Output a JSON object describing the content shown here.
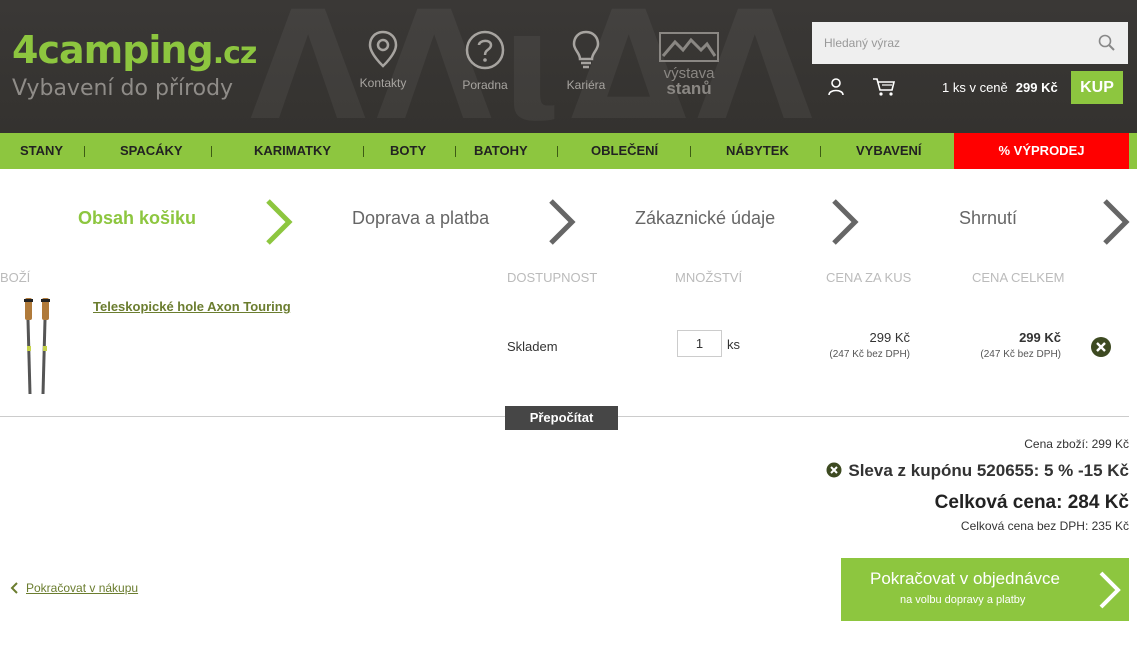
{
  "header": {
    "logo_main": "4camping",
    "logo_tld": ".cz",
    "logo_sub": "Vybavení do přírody",
    "links": [
      {
        "label": "Kontakty",
        "icon": "location-pin-icon"
      },
      {
        "label": "Poradna",
        "icon": "question-icon"
      },
      {
        "label": "Kariéra",
        "icon": "lightbulb-icon"
      }
    ],
    "vystava_line1": "výstava",
    "vystava_line2": "stanů",
    "search_placeholder": "Hledaný výraz",
    "cart_qty": "1 ks v ceně",
    "cart_price": "299 Kč",
    "buy_label": "KUP"
  },
  "nav": {
    "items": [
      "STANY",
      "SPACÁKY",
      "KARIMATKY",
      "BOTY",
      "BATOHY",
      "OBLEČENÍ",
      "NÁBYTEK",
      "VYBAVENÍ"
    ],
    "sale": "% VÝPRODEJ"
  },
  "steps": [
    "Obsah košiku",
    "Doprava a platba",
    "Zákaznické údaje",
    "Shrnutí"
  ],
  "table": {
    "headers": {
      "product": "ZBOŽÍ",
      "availability": "DOSTUPNOST",
      "quantity": "MNOŽSTVÍ",
      "unit_price": "CENA ZA KUS",
      "total_price": "CENA CELKEM"
    },
    "rows": [
      {
        "name": "Teleskopické hole Axon Touring",
        "availability": "Skladem",
        "quantity": "1",
        "unit": "ks",
        "unit_price": "299 Kč",
        "unit_price_net": "(247 Kč bez DPH)",
        "total_price": "299 Kč",
        "total_price_net": "(247 Kč bez DPH)"
      }
    ],
    "recalc_label": "Přepočítat"
  },
  "summary": {
    "goods": "Cena zboží: 299 Kč",
    "coupon": "Sleva z kupónu 520655: 5 % -15 Kč",
    "total": "Celková cena: 284 Kč",
    "total_net": "Celková cena bez DPH: 235 Kč"
  },
  "footer": {
    "back_label": "Pokračovat v nákupu",
    "continue_title": "Pokračovat v objednávce",
    "continue_sub": "na volbu dopravy a platby"
  },
  "colors": {
    "accent": "#8dc63f",
    "header_bg": "#393734",
    "sale": "#ff0000",
    "remove": "#3d4a21"
  }
}
